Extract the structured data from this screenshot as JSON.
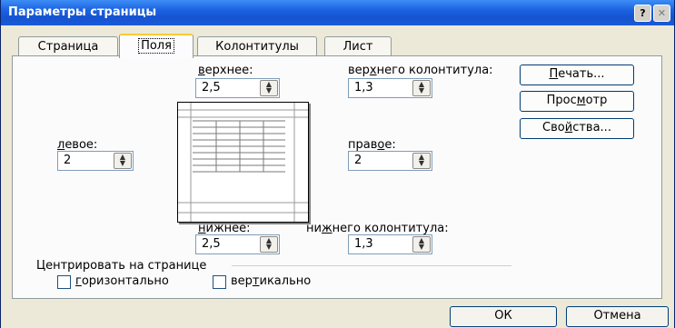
{
  "dialog": {
    "title": "Параметры страницы",
    "help_btn": "?",
    "close_btn": "✕"
  },
  "tabs": [
    {
      "label": "Страница",
      "active": false
    },
    {
      "label": "Поля",
      "active": true
    },
    {
      "label": "Колонтитулы",
      "active": false
    },
    {
      "label": "Лист",
      "active": false
    }
  ],
  "margins": {
    "top": {
      "label_pre": "",
      "label_u": "в",
      "label_post": "ерхнее:",
      "value": "2,5"
    },
    "header": {
      "label_pre": "вер",
      "label_u": "х",
      "label_post": "него колонтитула:",
      "value": "1,3"
    },
    "left": {
      "label_pre": "",
      "label_u": "л",
      "label_post": "евое:",
      "value": "2"
    },
    "right": {
      "label_pre": "прав",
      "label_u": "о",
      "label_post": "е:",
      "value": "2"
    },
    "bottom": {
      "label_pre": "",
      "label_u": "н",
      "label_post": "ижнее:",
      "value": "2,5"
    },
    "footer": {
      "label_pre": "ни",
      "label_u": "ж",
      "label_post": "него колонтитула:",
      "value": "1,3"
    }
  },
  "buttons": {
    "print": {
      "pre": "",
      "u": "П",
      "post": "ечать..."
    },
    "preview": {
      "pre": "Прос",
      "u": "м",
      "post": "отр"
    },
    "properties": {
      "pre": "Сво",
      "u": "й",
      "post": "ства..."
    }
  },
  "center": {
    "group_label": "Центрировать на странице",
    "horizontal": {
      "pre": "",
      "u": "г",
      "post": "оризонтально",
      "checked": false
    },
    "vertical": {
      "pre": "вер",
      "u": "т",
      "post": "икально",
      "checked": false
    }
  },
  "footer": {
    "ok": "ОК",
    "cancel": "Отмена"
  }
}
